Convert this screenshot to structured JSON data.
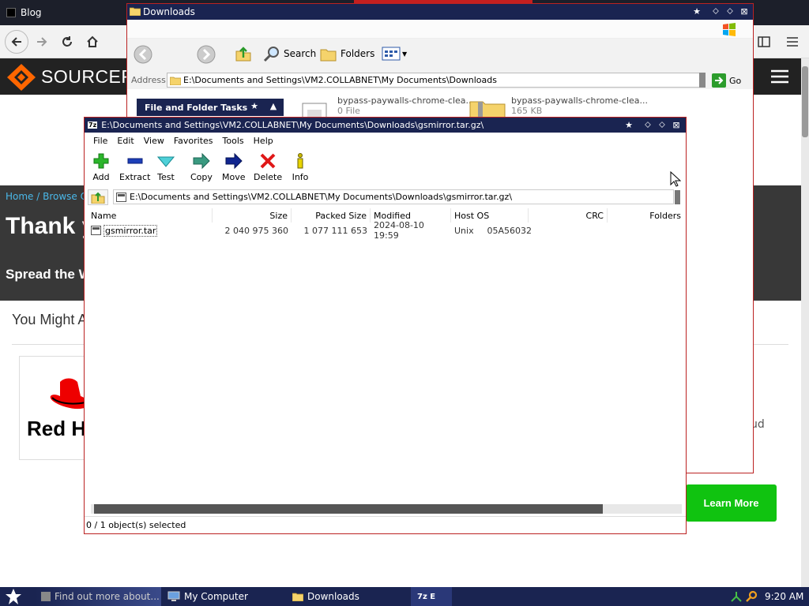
{
  "browser": {
    "tab_title": "Blog",
    "logo_text": "SOURCEF",
    "breadcrumb": "Home / Browse Op",
    "heading": "Thank y",
    "subheading": "Spread the W",
    "might_like": "You Might A",
    "card_brand": "Red H",
    "partial_text": "ud",
    "learn_more": "Learn More"
  },
  "explorer": {
    "title": "Downloads",
    "toolbar": {
      "search": "Search",
      "folders": "Folders"
    },
    "address_label": "Address",
    "address_value": "E:\\Documents and Settings\\VM2.COLLABNET\\My Documents\\Downloads",
    "go": "Go",
    "tasks_header": "File and Folder Tasks",
    "files": [
      {
        "name": "bypass-paywalls-chrome-clea...",
        "detail": "0 File"
      },
      {
        "name": "bypass-paywalls-chrome-clea...",
        "detail": "165 KB"
      }
    ]
  },
  "zip": {
    "title": "E:\\Documents and Settings\\VM2.COLLABNET\\My Documents\\Downloads\\gsmirror.tar.gz\\",
    "title_icon": "7z",
    "menu": [
      "File",
      "Edit",
      "View",
      "Favorites",
      "Tools",
      "Help"
    ],
    "toolbar": {
      "add": "Add",
      "extract": "Extract",
      "test": "Test",
      "copy": "Copy",
      "move": "Move",
      "delete": "Delete",
      "info": "Info"
    },
    "address": "E:\\Documents and Settings\\VM2.COLLABNET\\My Documents\\Downloads\\gsmirror.tar.gz\\",
    "columns": {
      "name": "Name",
      "size": "Size",
      "packed": "Packed Size",
      "modified": "Modified",
      "hostos": "Host OS",
      "crc": "CRC",
      "folders": "Folders"
    },
    "row": {
      "name": "gsmirror.tar",
      "size": "2 040 975 360",
      "packed": "1 077 111 653",
      "modified": "2024-08-10 19:59",
      "hostos": "Unix",
      "crc": "05A56032"
    },
    "status": "0 / 1 object(s) selected"
  },
  "taskbar": {
    "items": [
      {
        "label": "Find out more about..."
      },
      {
        "label": "My Computer"
      },
      {
        "label": "Downloads"
      },
      {
        "label": "7z E"
      }
    ],
    "clock": "9:20 AM"
  }
}
